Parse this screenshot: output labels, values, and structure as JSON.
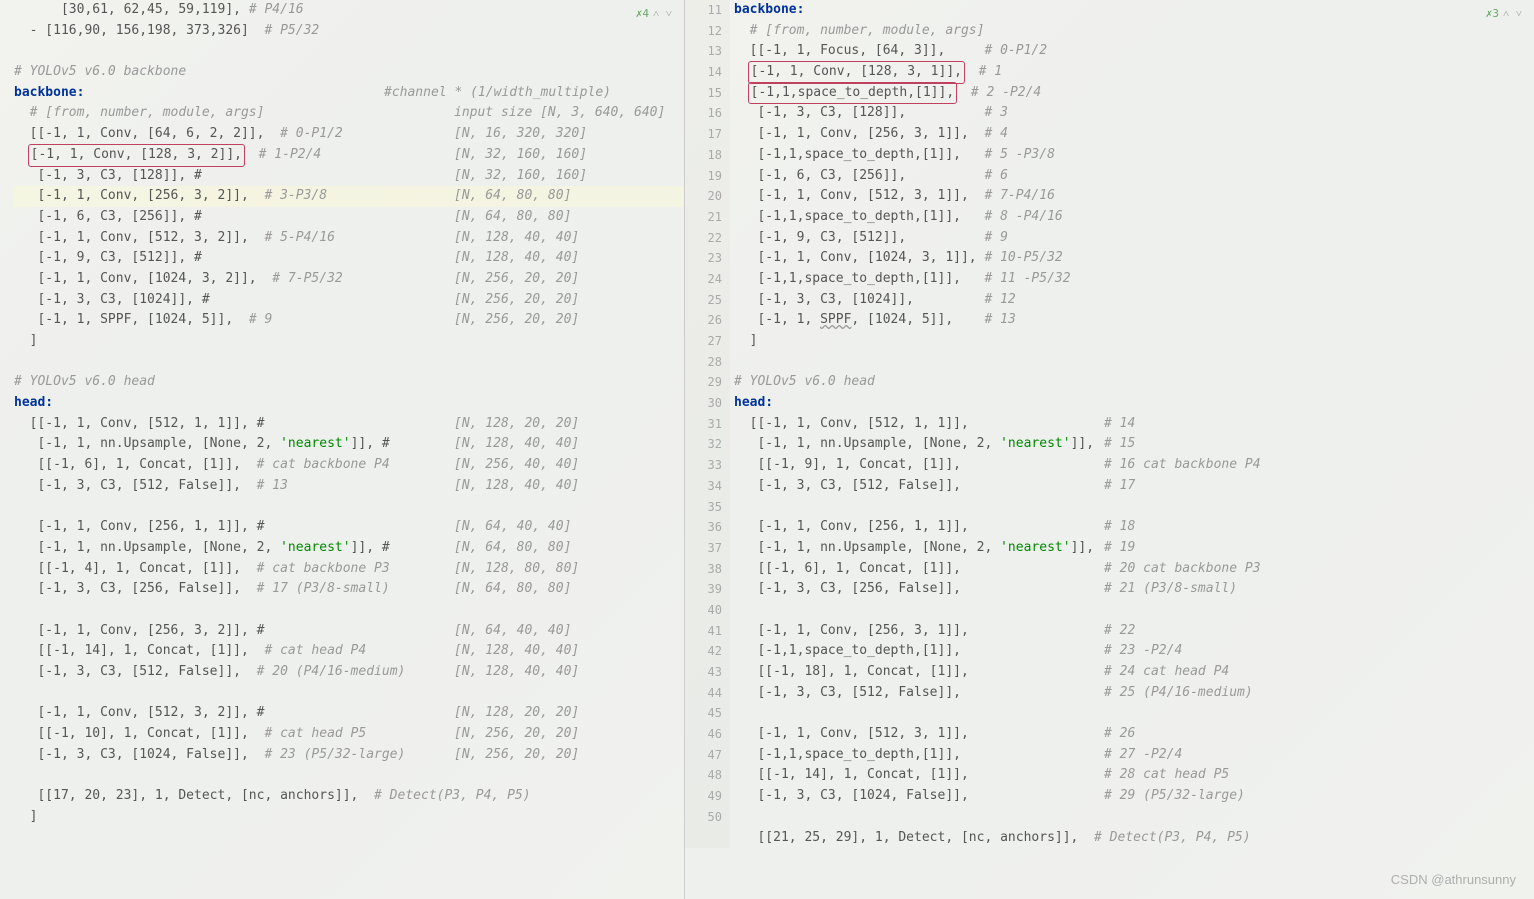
{
  "left_diff_badge": {
    "check": "✗",
    "count": "4",
    "arrows": "˄ ˅"
  },
  "right_diff_badge": {
    "check": "✗",
    "count": "3",
    "arrows": "˄ ˅"
  },
  "watermark": "CSDN @athrunsunny",
  "left_lines": [
    {
      "indent": 3,
      "content": "[30,61, 62,45, 59,119], ",
      "comment": "# P4/16",
      "faded": true
    },
    {
      "indent": 1,
      "prefix": "- ",
      "content": "[116,90, 156,198, 373,326]  ",
      "comment": "# P5/32"
    },
    {
      "indent": 0,
      "content": ""
    },
    {
      "indent": 0,
      "comment": "# YOLOv5 v6.0 backbone"
    },
    {
      "indent": 0,
      "content": "backbone:",
      "keyword": true,
      "side_channel": "#channel * (1/width_multiple)"
    },
    {
      "indent": 1,
      "comment": "# [from, number, module, args]",
      "side": "input size [N, 3, 640, 640]"
    },
    {
      "indent": 1,
      "content": "[[-1, 1, Conv, [64, 6, 2, 2]],  ",
      "comment": "# 0-P1/2",
      "side": "[N, 16, 320, 320]"
    },
    {
      "indent": 1,
      "content": " [-1, 1, Conv, [128, 3, 2]],",
      "box": true,
      "comment": "# 1-P2/4",
      "side": "[N, 32, 160, 160]"
    },
    {
      "indent": 1,
      "content": " [-1, 3, C3, [128]], #",
      "side": "[N, 32, 160, 160]"
    },
    {
      "indent": 1,
      "content": " [-1, 1, Conv, [256, 3, 2]],  ",
      "comment": "# 3-P3/8",
      "side": "[N, 64, 80, 80]",
      "highlight": true
    },
    {
      "indent": 1,
      "content": " [-1, 6, C3, [256]], #",
      "side": "[N, 64, 80, 80]"
    },
    {
      "indent": 1,
      "content": " [-1, 1, Conv, [512, 3, 2]],  ",
      "comment": "# 5-P4/16",
      "side": "[N, 128, 40, 40]"
    },
    {
      "indent": 1,
      "content": " [-1, 9, C3, [512]], #",
      "side": "[N, 128, 40, 40]"
    },
    {
      "indent": 1,
      "content": " [-1, 1, Conv, [1024, 3, 2]],  ",
      "comment": "# 7-P5/32",
      "side": "[N, 256, 20, 20]"
    },
    {
      "indent": 1,
      "content": " [-1, 3, C3, [1024]], #",
      "side": "[N, 256, 20, 20]"
    },
    {
      "indent": 1,
      "content": " [-1, 1, SPPF, [1024, 5]],  ",
      "comment": "# 9",
      "side": "[N, 256, 20, 20]"
    },
    {
      "indent": 1,
      "content": "]"
    },
    {
      "indent": 0,
      "content": ""
    },
    {
      "indent": 0,
      "comment": "# YOLOv5 v6.0 head"
    },
    {
      "indent": 0,
      "content": "head:",
      "keyword": true
    },
    {
      "indent": 1,
      "content": "[[-1, 1, Conv, [512, 1, 1]], #",
      "side": "[N, 128, 20, 20]"
    },
    {
      "indent": 1,
      "content": " [-1, 1, nn.Upsample, [None, 2, ",
      "string": "'nearest'",
      "content2": "]], #",
      "side": "[N, 128, 40, 40]"
    },
    {
      "indent": 1,
      "content": " [[-1, 6], 1, Concat, [1]],  ",
      "comment": "# cat backbone P4",
      "side": "[N, 256, 40, 40]"
    },
    {
      "indent": 1,
      "content": " [-1, 3, C3, [512, False]],  ",
      "comment": "# 13",
      "side": "[N, 128, 40, 40]"
    },
    {
      "indent": 0,
      "content": ""
    },
    {
      "indent": 1,
      "content": " [-1, 1, Conv, [256, 1, 1]], #",
      "side": "[N, 64, 40, 40]"
    },
    {
      "indent": 1,
      "content": " [-1, 1, nn.Upsample, [None, 2, ",
      "string": "'nearest'",
      "content2": "]], #",
      "side": "[N, 64, 80, 80]"
    },
    {
      "indent": 1,
      "content": " [[-1, 4], 1, Concat, [1]],  ",
      "comment": "# cat backbone P3",
      "side": "[N, 128, 80, 80]"
    },
    {
      "indent": 1,
      "content": " [-1, 3, C3, [256, False]],  ",
      "comment": "# 17 (P3/8-small)",
      "side": "[N, 64, 80, 80]"
    },
    {
      "indent": 0,
      "content": ""
    },
    {
      "indent": 1,
      "content": " [-1, 1, Conv, [256, 3, 2]], #",
      "side": "[N, 64, 40, 40]"
    },
    {
      "indent": 1,
      "content": " [[-1, 14], 1, Concat, [1]],  ",
      "comment": "# cat head P4",
      "side": "[N, 128, 40, 40]"
    },
    {
      "indent": 1,
      "content": " [-1, 3, C3, [512, False]],  ",
      "comment": "# 20 (P4/16-medium)",
      "side": "[N, 128, 40, 40]"
    },
    {
      "indent": 0,
      "content": ""
    },
    {
      "indent": 1,
      "content": " [-1, 1, Conv, [512, 3, 2]], #",
      "side": "[N, 128, 20, 20]"
    },
    {
      "indent": 1,
      "content": " [[-1, 10], 1, Concat, [1]],  ",
      "comment": "# cat head P5",
      "side": "[N, 256, 20, 20]"
    },
    {
      "indent": 1,
      "content": " [-1, 3, C3, [1024, False]],  ",
      "comment": "# 23 (P5/32-large)",
      "side": "[N, 256, 20, 20]"
    },
    {
      "indent": 0,
      "content": ""
    },
    {
      "indent": 1,
      "content": " [[17, 20, 23], 1, Detect, [nc, anchors]],  ",
      "comment": "# Detect(P3, P4, P5)"
    },
    {
      "indent": 1,
      "content": "]"
    }
  ],
  "right_lines": [
    {
      "num": "11",
      "indent": 0,
      "content": "backbone:",
      "keyword": true,
      "faded": true
    },
    {
      "num": "12",
      "indent": 1,
      "comment": "# [from, number, module, args]"
    },
    {
      "num": "13",
      "indent": 1,
      "content": "[[-1, 1, Focus, [64, 3]],     ",
      "comment": "# 0-P1/2"
    },
    {
      "num": "14",
      "indent": 1,
      "content": " [-1, 1, Conv, [128, 3, 1]],  ",
      "comment": "# 1",
      "box": "start"
    },
    {
      "num": "15",
      "indent": 1,
      "content": " [-1,1,space_to_depth,[1]],   ",
      "comment": "# 2 -P2/4",
      "box": "end"
    },
    {
      "num": "16",
      "indent": 1,
      "content": " [-1, 3, C3, [128]],          ",
      "comment": "# 3"
    },
    {
      "num": "17",
      "indent": 1,
      "content": " [-1, 1, Conv, [256, 3, 1]],  ",
      "comment": "# 4"
    },
    {
      "num": "18",
      "indent": 1,
      "content": " [-1,1,space_to_depth,[1]],   ",
      "comment": "# 5 -P3/8"
    },
    {
      "num": "19",
      "indent": 1,
      "content": " [-1, 6, C3, [256]],          ",
      "comment": "# 6"
    },
    {
      "num": "20",
      "indent": 1,
      "content": " [-1, 1, Conv, [512, 3, 1]],  ",
      "comment": "# 7-P4/16"
    },
    {
      "num": "21",
      "indent": 1,
      "content": " [-1,1,space_to_depth,[1]],   ",
      "comment": "# 8 -P4/16"
    },
    {
      "num": "22",
      "indent": 1,
      "content": " [-1, 9, C3, [512]],          ",
      "comment": "# 9"
    },
    {
      "num": "23",
      "indent": 1,
      "content": " [-1, 1, Conv, [1024, 3, 1]], ",
      "comment": "# 10-P5/32"
    },
    {
      "num": "24",
      "indent": 1,
      "content": " [-1,1,space_to_depth,[1]],   ",
      "comment": "# 11 -P5/32"
    },
    {
      "num": "25",
      "indent": 1,
      "content": " [-1, 3, C3, [1024]],         ",
      "comment": "# 12"
    },
    {
      "num": "26",
      "indent": 1,
      "content": " [-1, 1, SPPF, [1024, 5]],    ",
      "comment": "# 13",
      "underline": "SPPF"
    },
    {
      "num": "27",
      "indent": 1,
      "content": "]"
    },
    {
      "num": "28",
      "indent": 0,
      "content": ""
    },
    {
      "num": "29",
      "indent": 0,
      "comment": "# YOLOv5 v6.0 head"
    },
    {
      "num": "30",
      "indent": 0,
      "content": "head:",
      "keyword": true
    },
    {
      "num": "31",
      "indent": 1,
      "content": "[[-1, 1, Conv, [512, 1, 1]],",
      "rside": "# 14"
    },
    {
      "num": "32",
      "indent": 1,
      "content": " [-1, 1, nn.Upsample, [None, 2, ",
      "string": "'nearest'",
      "content2": "]],",
      "rside": "# 15"
    },
    {
      "num": "33",
      "indent": 1,
      "content": " [[-1, 9], 1, Concat, [1]],",
      "rside": "# 16 cat backbone P4"
    },
    {
      "num": "34",
      "indent": 1,
      "content": " [-1, 3, C3, [512, False]],",
      "rside": "# 17"
    },
    {
      "num": "35",
      "indent": 0,
      "content": ""
    },
    {
      "num": "36",
      "indent": 1,
      "content": " [-1, 1, Conv, [256, 1, 1]],",
      "rside": "# 18"
    },
    {
      "num": "37",
      "indent": 1,
      "content": " [-1, 1, nn.Upsample, [None, 2, ",
      "string": "'nearest'",
      "content2": "]],",
      "rside": "# 19"
    },
    {
      "num": "38",
      "indent": 1,
      "content": " [[-1, 6], 1, Concat, [1]],",
      "rside": "# 20 cat backbone P3"
    },
    {
      "num": "39",
      "indent": 1,
      "content": " [-1, 3, C3, [256, False]],",
      "rside": "# 21 (P3/8-small)"
    },
    {
      "num": "40",
      "indent": 0,
      "content": ""
    },
    {
      "num": "41",
      "indent": 1,
      "content": " [-1, 1, Conv, [256, 3, 1]],",
      "rside": "# 22"
    },
    {
      "num": "42",
      "indent": 1,
      "content": " [-1,1,space_to_depth,[1]],",
      "rside": "# 23 -P2/4"
    },
    {
      "num": "43",
      "indent": 1,
      "content": " [[-1, 18], 1, Concat, [1]],",
      "rside": "# 24 cat head P4"
    },
    {
      "num": "44",
      "indent": 1,
      "content": " [-1, 3, C3, [512, False]],",
      "rside": "# 25 (P4/16-medium)"
    },
    {
      "num": "45",
      "indent": 0,
      "content": ""
    },
    {
      "num": "46",
      "indent": 1,
      "content": " [-1, 1, Conv, [512, 3, 1]],",
      "rside": "# 26"
    },
    {
      "num": "47",
      "indent": 1,
      "content": " [-1,1,space_to_depth,[1]],",
      "rside": "# 27 -P2/4"
    },
    {
      "num": "48",
      "indent": 1,
      "content": " [[-1, 14], 1, Concat, [1]],",
      "rside": "# 28 cat head P5"
    },
    {
      "num": "49",
      "indent": 1,
      "content": " [-1, 3, C3, [1024, False]],",
      "rside": "# 29 (P5/32-large)"
    },
    {
      "num": "50",
      "indent": 0,
      "content": ""
    },
    {
      "num": "",
      "indent": 1,
      "content": " [[21, 25, 29], 1, Detect, [nc, anchors]],  ",
      "comment": "# Detect(P3, P4, P5)"
    }
  ]
}
